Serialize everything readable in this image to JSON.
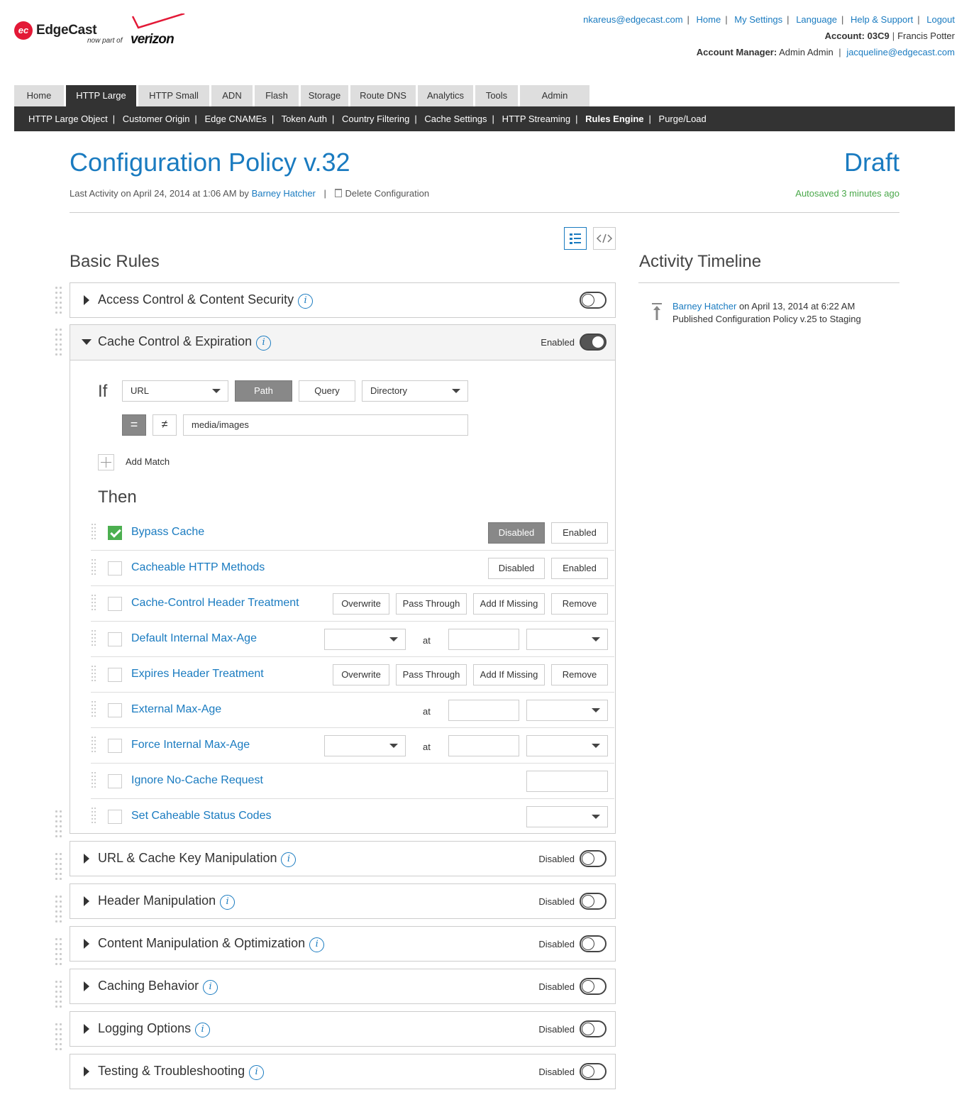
{
  "brand": {
    "logo_badge": "ec",
    "logo_text": "EdgeCast",
    "logo_sub": "now part of",
    "logo_vz": "verizon"
  },
  "toplinks": [
    "nkareus@edgecast.com",
    "Home",
    "My Settings",
    "Language",
    "Help & Support",
    "Logout"
  ],
  "account": {
    "label": "Account:",
    "id": "03C9",
    "name": "Francis Potter"
  },
  "manager": {
    "label": "Account Manager:",
    "name": "Admin Admin",
    "email": "jacqueline@edgecast.com"
  },
  "tabs": [
    "Home",
    "HTTP Large",
    "HTTP Small",
    "ADN",
    "Flash",
    "Storage",
    "Route DNS",
    "Analytics",
    "Tools",
    "Admin"
  ],
  "active_tab": "HTTP Large",
  "subnav": [
    "HTTP Large Object",
    "Customer Origin",
    "Edge CNAMEs",
    "Token Auth",
    "Country Filtering",
    "Cache Settings",
    "HTTP Streaming",
    "Rules Engine",
    "Purge/Load"
  ],
  "active_subnav": "Rules Engine",
  "page": {
    "title": "Configuration Policy v.32",
    "status": "Draft",
    "meta_prefix": "Last Activity on April 24, 2014 at 1:06 AM by",
    "meta_user": "Barney Hatcher",
    "delete_label": "Delete Configuration",
    "autosaved": "Autosaved 3 minutes ago"
  },
  "basic_rules_heading": "Basic Rules",
  "panels": {
    "access": {
      "title": "Access Control & Content Security",
      "status": ""
    },
    "cache": {
      "title": "Cache Control & Expiration",
      "status": "Enabled"
    },
    "url": {
      "title": "URL & Cache Key Manipulation",
      "status": "Disabled"
    },
    "header": {
      "title": "Header Manipulation",
      "status": "Disabled"
    },
    "content": {
      "title": "Content Manipulation & Optimization",
      "status": "Disabled"
    },
    "caching": {
      "title": "Caching Behavior",
      "status": "Disabled"
    },
    "logging": {
      "title": "Logging Options",
      "status": "Disabled"
    },
    "testing": {
      "title": "Testing & Troubleshooting",
      "status": "Disabled"
    }
  },
  "condition": {
    "if_label": "If",
    "match_type": "URL",
    "path_btn": "Path",
    "query_btn": "Query",
    "directory": "Directory",
    "eq": "=",
    "neq": "≠",
    "value": "media/images",
    "add_match": "Add Match"
  },
  "then_label": "Then",
  "rules": {
    "bypass": {
      "name": "Bypass Cache",
      "disabled": "Disabled",
      "enabled": "Enabled",
      "checked": true
    },
    "methods": {
      "name": "Cacheable HTTP Methods",
      "disabled": "Disabled",
      "enabled": "Enabled"
    },
    "cc_header": {
      "name": "Cache-Control Header Treatment",
      "overwrite": "Overwrite",
      "pass": "Pass Through",
      "add": "Add If Missing",
      "remove": "Remove"
    },
    "default_max": {
      "name": "Default Internal Max-Age",
      "at": "at"
    },
    "expires": {
      "name": "Expires Header Treatment",
      "overwrite": "Overwrite",
      "pass": "Pass Through",
      "add": "Add If Missing",
      "remove": "Remove"
    },
    "external_max": {
      "name": "External Max-Age",
      "at": "at"
    },
    "force_max": {
      "name": "Force Internal Max-Age",
      "at": "at"
    },
    "ignore_nocache": {
      "name": "Ignore No-Cache Request"
    },
    "status_codes": {
      "name": "Set Caheable Status Codes"
    }
  },
  "timeline": {
    "heading": "Activity Timeline",
    "user": "Barney Hatcher",
    "when": "on April 13, 2014 at 6:22 AM",
    "action": "Published Configuration Policy v.25 to Staging"
  },
  "colors": {
    "link": "#1a7bc0",
    "autosaved": "#4aa84a",
    "nav_bg": "#333333",
    "checked": "#4caf50"
  },
  "icons": [
    "info-icon",
    "trash-icon",
    "list-view-icon",
    "code-view-icon",
    "publish-arrow-icon",
    "drag-handle-icon",
    "caret-down-icon",
    "plus-icon",
    "checkmark-icon"
  ]
}
